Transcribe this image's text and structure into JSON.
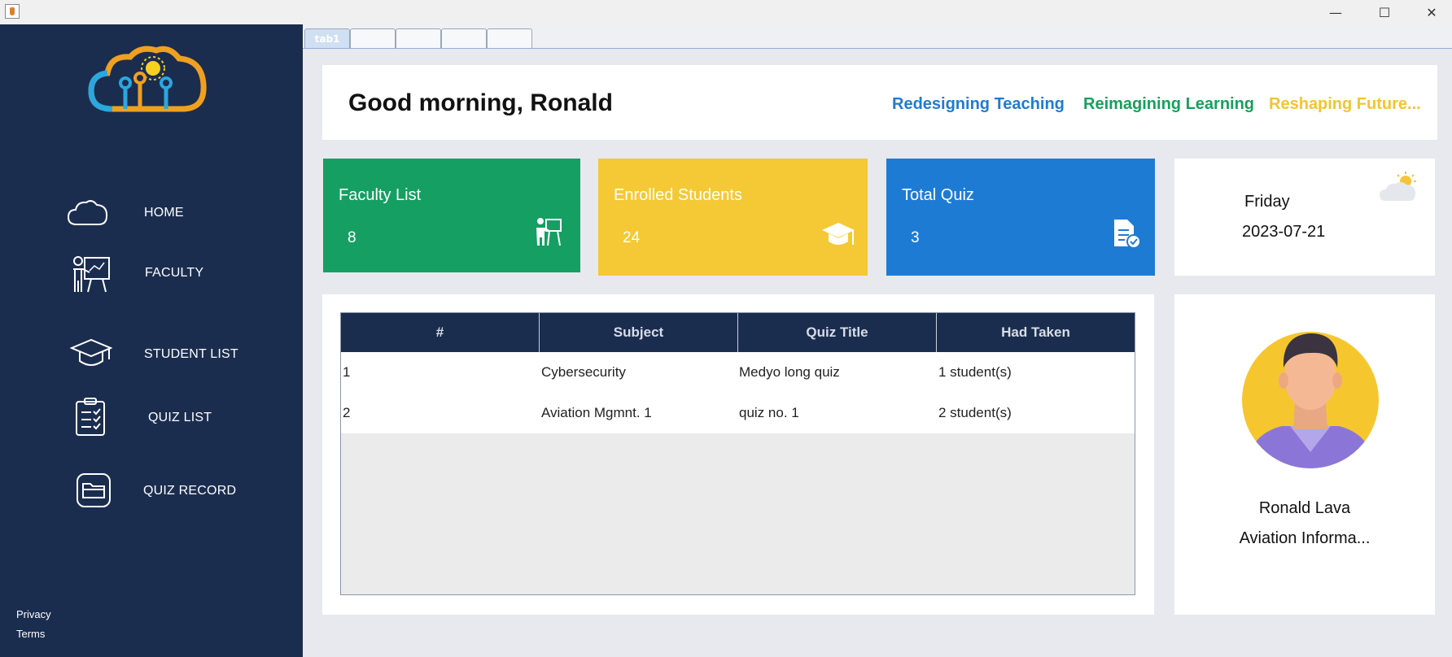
{
  "window": {
    "minimize_glyph": "—",
    "maximize_glyph": "☐",
    "close_glyph": "✕"
  },
  "sidebar": {
    "items": [
      {
        "label": "HOME",
        "icon": "cloud-icon"
      },
      {
        "label": "FACULTY",
        "icon": "teacher-board-icon"
      },
      {
        "label": "STUDENT LIST",
        "icon": "graduation-cap-icon"
      },
      {
        "label": "QUIZ LIST",
        "icon": "clipboard-checklist-icon"
      },
      {
        "label": "QUIZ RECORD",
        "icon": "folder-icon"
      }
    ],
    "footer": {
      "privacy": "Privacy",
      "terms": "Terms"
    }
  },
  "tabs": [
    "tab1",
    "",
    "",
    "",
    ""
  ],
  "header": {
    "greeting": "Good morning, Ronald",
    "slogans": [
      {
        "text": "Redesigning Teaching",
        "color": "#1e7bd4"
      },
      {
        "text": "Reimagining Learning",
        "color": "#17a05d"
      },
      {
        "text": "Reshaping Future...",
        "color": "#f4c430"
      }
    ]
  },
  "stats": [
    {
      "title": "Faculty List",
      "value": "8",
      "color": "#159f62",
      "icon": "teacher-icon"
    },
    {
      "title": "Enrolled Students",
      "value": "24",
      "color": "#f4c935",
      "icon": "graduation-cap-icon"
    },
    {
      "title": "Total Quiz",
      "value": "3",
      "color": "#1e7bd4",
      "icon": "quiz-document-icon"
    }
  ],
  "date_card": {
    "day": "Friday",
    "date": "2023-07-21",
    "icon": "partly-cloudy-icon"
  },
  "quiz_table": {
    "headers": [
      "#",
      "Subject",
      "Quiz Title",
      "Had Taken"
    ],
    "rows": [
      [
        "1",
        "Cybersecurity",
        "Medyo long quiz",
        "1 student(s)"
      ],
      [
        "2",
        "Aviation Mgmnt. 1",
        "quiz no. 1",
        "2 student(s)"
      ]
    ],
    "header_color": "#1b2d4f"
  },
  "profile": {
    "name": "Ronald Lava",
    "department": "Aviation Informa..."
  },
  "colors": {
    "sidebar": "#1b2d4f",
    "background": "#e7e9ee"
  }
}
